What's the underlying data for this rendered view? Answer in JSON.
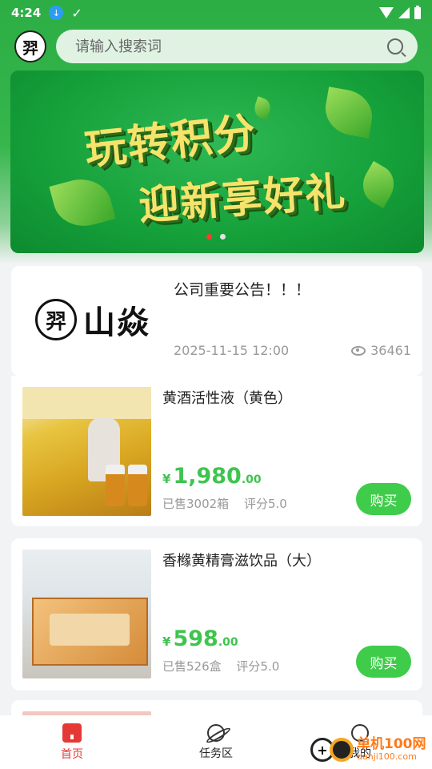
{
  "status_bar": {
    "time": "4:24"
  },
  "search": {
    "placeholder": "请输入搜索词"
  },
  "banner": {
    "line1": "玩转积分",
    "line2": "迎新享好礼",
    "active_index": 0,
    "count": 2
  },
  "notice": {
    "title": "公司重要公告！！！",
    "logo_text": "山焱",
    "logo_mark": "羿",
    "date": "2025-11-15 12:00",
    "views": "36461"
  },
  "products": [
    {
      "name": "黄酒活性液（黄色）",
      "currency": "¥",
      "price_int": "1,980",
      "price_dec": ".00",
      "sold": "已售3002箱",
      "rating": "评分5.0",
      "buy_label": "购买"
    },
    {
      "name": "香橼黄精膏滋饮品（大）",
      "currency": "¥",
      "price_int": "598",
      "price_dec": ".00",
      "sold": "已售526盒",
      "rating": "评分5.0",
      "buy_label": "购买"
    },
    {
      "name": "",
      "currency": "",
      "price_int": "",
      "price_dec": "",
      "sold": "",
      "rating": "",
      "buy_label": ""
    }
  ],
  "nav": {
    "items": [
      {
        "label": "首页",
        "icon": "home-icon",
        "active": true
      },
      {
        "label": "任务区",
        "icon": "planet-icon",
        "active": false
      },
      {
        "label": "我的",
        "icon": "smile-icon",
        "active": false
      }
    ]
  },
  "watermark": {
    "line1": "单机100网",
    "line2": "danji100.com"
  },
  "colors": {
    "brand_green": "#2cae44",
    "buy_green": "#3fcc4a",
    "price_green": "#3fc44f",
    "nav_active": "#e53935"
  }
}
